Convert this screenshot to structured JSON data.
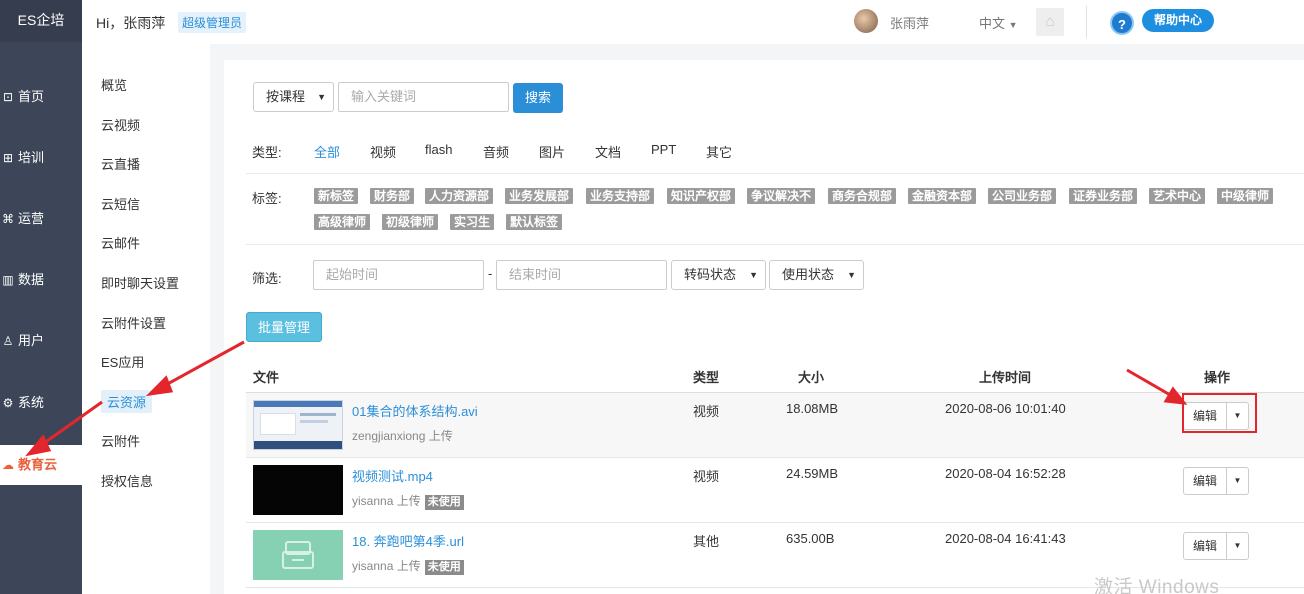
{
  "brand": "ES企培",
  "leftnav": [
    {
      "icon": "chart-line-icon",
      "glyph": "⊡",
      "label": "首页"
    },
    {
      "icon": "training-icon",
      "glyph": "⊞",
      "label": "培训"
    },
    {
      "icon": "operation-icon",
      "glyph": "⌘",
      "label": "运营"
    },
    {
      "icon": "bar-chart-icon",
      "glyph": "▥",
      "label": "数据"
    },
    {
      "icon": "user-icon",
      "glyph": "♙",
      "label": "用户"
    },
    {
      "icon": "gear-icon",
      "glyph": "⚙",
      "label": "系统"
    },
    {
      "icon": "cloud-icon",
      "glyph": "☁",
      "label": "教育云"
    }
  ],
  "header": {
    "greeting": "Hi，张雨萍",
    "role_badge": "超级管理员",
    "username": "张雨萍",
    "language": "中文",
    "help_label": "帮助中心",
    "help_glyph": "?"
  },
  "subnav": [
    "概览",
    "云视频",
    "云直播",
    "云短信",
    "云邮件",
    "即时聊天设置",
    "云附件设置",
    "ES应用",
    "云资源",
    "云附件",
    "授权信息"
  ],
  "search": {
    "mode": "按课程",
    "placeholder": "输入关键词",
    "button": "搜索"
  },
  "filters": {
    "type_label": "类型:",
    "types": [
      "全部",
      "视频",
      "flash",
      "音频",
      "图片",
      "文档",
      "PPT",
      "其它"
    ],
    "tag_label": "标签:",
    "tags_row1": [
      "新标签",
      "财务部",
      "人力资源部",
      "业务发展部",
      "业务支持部",
      "知识产权部",
      "争议解决不",
      "商务合规部",
      "金融资本部",
      "公司业务部",
      "证券业务部",
      "艺术中心",
      "中级律师"
    ],
    "tags_row2": [
      "高级律师",
      "初级律师",
      "实习生",
      "默认标签"
    ],
    "screen_label": "筛选:",
    "start_placeholder": "起始时间",
    "dash": "-",
    "end_placeholder": "结束时间",
    "transcode": "转码状态",
    "usage": "使用状态"
  },
  "batch_button": "批量管理",
  "table": {
    "headers": {
      "file": "文件",
      "type": "类型",
      "size": "大小",
      "time": "上传时间",
      "ops": "操作"
    },
    "rows": [
      {
        "name": "01集合的体系结构.avi",
        "uploader": "zengjianxiong 上传",
        "unused": "",
        "type": "视频",
        "size": "18.08MB",
        "time": "2020-08-06 10:01:40",
        "edit": "编辑",
        "thumb": "screenshot"
      },
      {
        "name": "视频测试.mp4",
        "uploader": "yisanna 上传",
        "unused": "未使用",
        "type": "视频",
        "size": "24.59MB",
        "time": "2020-08-04 16:52:28",
        "edit": "编辑",
        "thumb": "black"
      },
      {
        "name": "18. 奔跑吧第4季.url",
        "uploader": "yisanna 上传",
        "unused": "未使用",
        "type": "其他",
        "size": "635.00B",
        "time": "2020-08-04 16:41:43",
        "edit": "编辑",
        "thumb": "file"
      }
    ]
  },
  "watermark": "激活 Windows",
  "colors": {
    "accent": "#2b8fd8",
    "nav_bg": "#3d4659",
    "annotation_red": "#e3262c",
    "active_nav_text": "#e8603c"
  }
}
